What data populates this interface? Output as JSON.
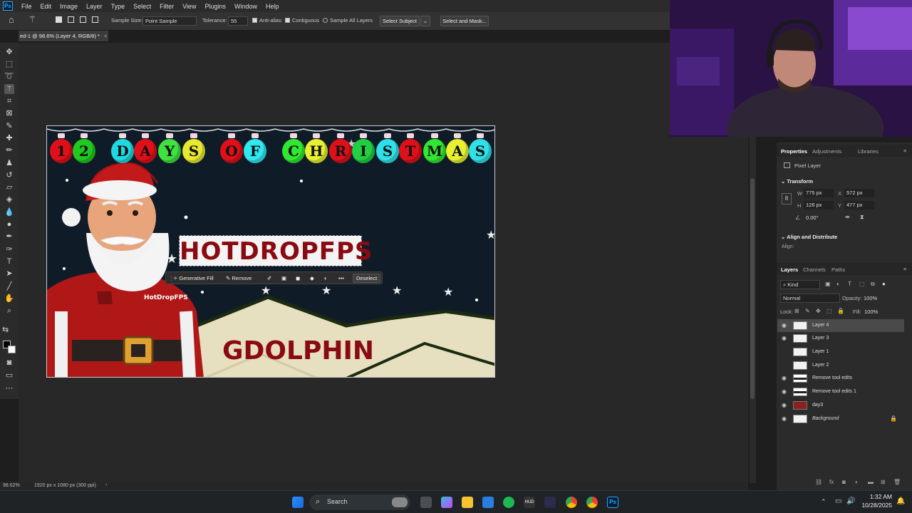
{
  "menubar": {
    "items": [
      "File",
      "Edit",
      "Image",
      "Layer",
      "Type",
      "Select",
      "Filter",
      "View",
      "Plugins",
      "Window",
      "Help"
    ]
  },
  "options": {
    "sample_size_label": "Sample Size:",
    "sample_size_value": "Point Sample",
    "tolerance_label": "Tolerance:",
    "tolerance_value": "55",
    "anti_alias": "Anti-alias",
    "contiguous": "Contiguous",
    "sample_all_layers": "Sample All Layers",
    "select_subject": "Select Subject",
    "select_and_mask": "Select and Mask..."
  },
  "document": {
    "tab_label": "ed-1 @ 98.6% (Layer 4, RGB/8) *",
    "zoom": "98.62%",
    "doc_info": "1920 px x 1080 px (300 ppi)"
  },
  "canvas": {
    "title_letters": [
      "1",
      "2",
      "D",
      "A",
      "Y",
      "S",
      "O",
      "F",
      "C",
      "H",
      "R",
      "I",
      "S",
      "T",
      "M",
      "A",
      "S"
    ],
    "ornament_colors": [
      "#e0101a",
      "#20c820",
      "#20d8e0",
      "#e0101a",
      "#40e040",
      "#e8e830",
      "#e0101a",
      "#30e8f0",
      "#30e830",
      "#e8f030",
      "#e0101a",
      "#20d040",
      "#30e0e8",
      "#e0101a",
      "#30e830",
      "#e8f030",
      "#30e0e8"
    ],
    "headline": "HOTDROPFPS",
    "shirt_text": "HotDropFPS",
    "bottom_text": "GDOLPHIN"
  },
  "contextbar": {
    "generative_fill": "Generative Fill",
    "remove": "Remove",
    "deselect": "Deselect",
    "more": "•••"
  },
  "properties": {
    "tabs": [
      "Properties",
      "Adjustments",
      "Libraries"
    ],
    "pixel_layer": "Pixel Layer",
    "transform_title": "Transform",
    "w_label": "W",
    "w_value": "775 px",
    "h_label": "H",
    "h_value": "126 px",
    "x_label": "X",
    "x_value": "572 px",
    "y_label": "Y",
    "y_value": "477 px",
    "angle": "0.00°",
    "align_title": "Align and Distribute",
    "align_label": "Align:"
  },
  "layers_panel": {
    "tabs": [
      "Layers",
      "Channels",
      "Paths"
    ],
    "kind": "Kind",
    "blend_mode": "Normal",
    "opacity_label": "Opacity:",
    "opacity_value": "100%",
    "lock_label": "Lock:",
    "fill_label": "Fill:",
    "fill_value": "100%",
    "layers": [
      {
        "name": "Layer 4",
        "visible": true
      },
      {
        "name": "Layer 3",
        "visible": true
      },
      {
        "name": "Layer 1",
        "visible": false
      },
      {
        "name": "Layer 2",
        "visible": false
      },
      {
        "name": "Remove tool edits",
        "visible": true
      },
      {
        "name": "Remove tool edits 1",
        "visible": true
      },
      {
        "name": "day3",
        "visible": true
      },
      {
        "name": "Background",
        "visible": true
      }
    ]
  },
  "taskbar": {
    "search": "Search",
    "time": "1:32 AM",
    "date": "10/28/2025"
  },
  "colors": {
    "accent": "#31a8ff",
    "canvas_bg": "#0e1a25",
    "headline_red": "#8a0a12",
    "selected_layer": "#4a4a4a"
  }
}
